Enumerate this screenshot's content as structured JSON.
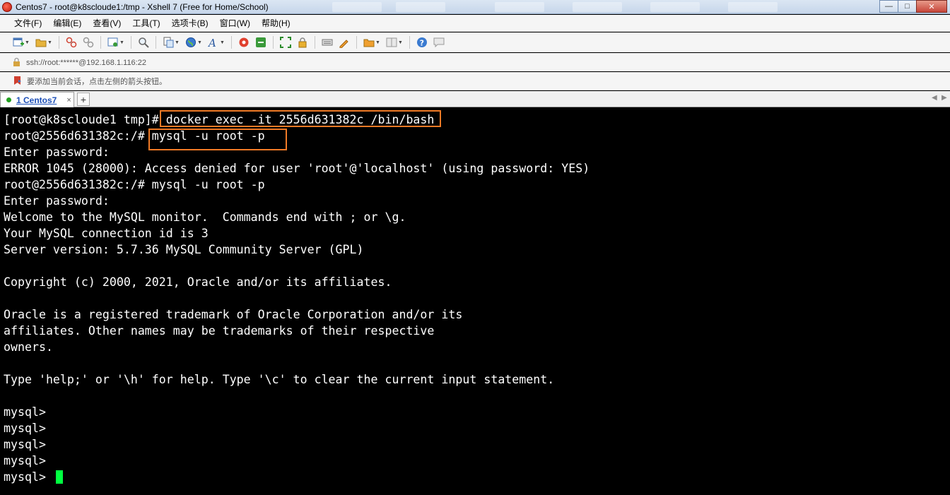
{
  "window": {
    "title": "Centos7 - root@k8scloude1:/tmp - Xshell 7 (Free for Home/School)"
  },
  "menu": {
    "items": [
      "文件(F)",
      "编辑(E)",
      "查看(V)",
      "工具(T)",
      "选项卡(B)",
      "窗口(W)",
      "帮助(H)"
    ]
  },
  "address": {
    "text": "ssh://root:******@192.168.1.116:22"
  },
  "hint": {
    "text": "要添加当前会话，点击左侧的箭头按钮。"
  },
  "tabs": {
    "active_label": "1 Centos7",
    "close_glyph": "×",
    "add_glyph": "+"
  },
  "terminal": {
    "lines": [
      "[root@k8scloude1 tmp]# docker exec -it 2556d631382c /bin/bash",
      "root@2556d631382c:/# mysql -u root -p",
      "Enter password:",
      "ERROR 1045 (28000): Access denied for user 'root'@'localhost' (using password: YES)",
      "root@2556d631382c:/# mysql -u root -p",
      "Enter password:",
      "Welcome to the MySQL monitor.  Commands end with ; or \\g.",
      "Your MySQL connection id is 3",
      "Server version: 5.7.36 MySQL Community Server (GPL)",
      "",
      "Copyright (c) 2000, 2021, Oracle and/or its affiliates.",
      "",
      "Oracle is a registered trademark of Oracle Corporation and/or its",
      "affiliates. Other names may be trademarks of their respective",
      "owners.",
      "",
      "Type 'help;' or '\\h' for help. Type '\\c' to clear the current input statement.",
      "",
      "mysql>",
      "mysql>",
      "mysql>",
      "mysql>",
      "mysql> "
    ],
    "cursor_color": "#00ff40",
    "highlight_color": "#f07a26"
  },
  "icons": [
    "new-session-icon",
    "open-folder-icon",
    "connect-icon",
    "disconnect-icon",
    "properties-icon",
    "search-icon",
    "copy-paste-icon",
    "globe-icon",
    "font-icon",
    "xftp-icon",
    "tunnel-icon",
    "fullscreen-icon",
    "lock-icon",
    "keyboard-icon",
    "script-icon",
    "add-to-folder-icon",
    "layout-icon",
    "help-icon",
    "chat-icon"
  ]
}
